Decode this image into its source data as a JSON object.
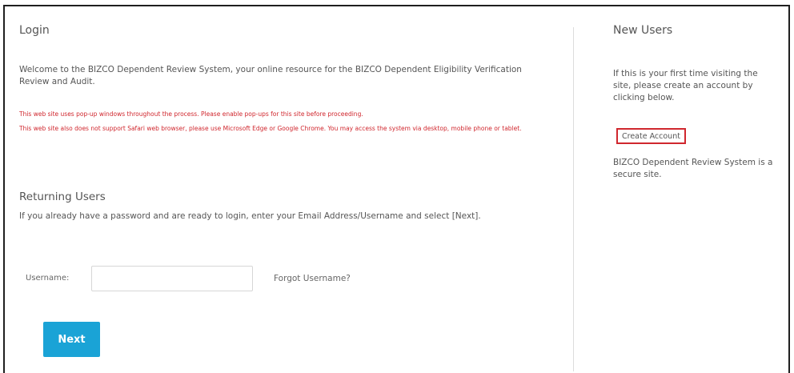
{
  "login": {
    "title": "Login",
    "welcome": "Welcome to the BIZCO Dependent Review System, your online resource for the BIZCO Dependent Eligibility Verification Review and Audit.",
    "warning_popups": "This web site uses pop-up windows throughout the process. Please enable pop-ups for this site before proceeding.",
    "warning_browser": "This web site also does not support Safari web browser, please use Microsoft Edge or Google Chrome. You may access the system via desktop, mobile phone or tablet."
  },
  "returning": {
    "title": "Returning Users",
    "description": "If you already have a password and are ready to login, enter your Email Address/Username and select [Next].",
    "username_label": "Username:",
    "username_value": "",
    "username_placeholder": "",
    "forgot_username": "Forgot Username?",
    "next_label": "Next"
  },
  "new_users": {
    "title": "New Users",
    "description": "If this is your first time visiting the site, please create an account by clicking below.",
    "create_account": "Create Account",
    "secure_text": "BIZCO Dependent Review System is a secure site."
  },
  "colors": {
    "accent": "#1aa3d6",
    "warning": "#d0272e",
    "border": "#1f1f1f"
  }
}
